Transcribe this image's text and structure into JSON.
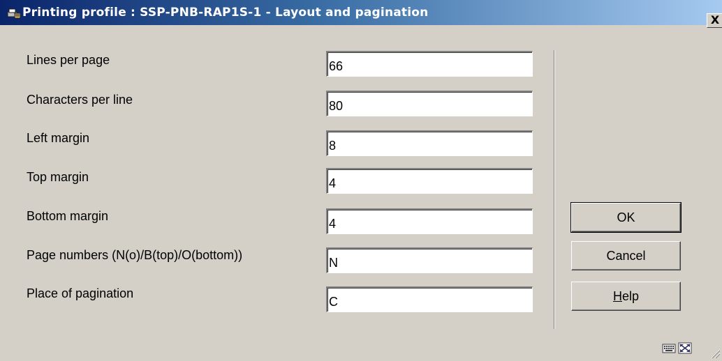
{
  "window": {
    "title": "Printing profile : SSP-PNB-RAP1S-1 - Layout and pagination",
    "close_label": "X"
  },
  "fields": [
    {
      "label": "Lines per page",
      "value": "66"
    },
    {
      "label": "Characters per line",
      "value": "80"
    },
    {
      "label": "Left margin",
      "value": "8"
    },
    {
      "label": "Top margin",
      "value": "4"
    },
    {
      "label": "Bottom margin",
      "value": "4"
    },
    {
      "label": "Page numbers (N(o)/B(top)/O(bottom))",
      "value": "N"
    },
    {
      "label": "Place of pagination",
      "value": "C"
    }
  ],
  "buttons": {
    "ok": "OK",
    "cancel": "Cancel",
    "help_mnemonic": "H",
    "help_rest": "elp"
  },
  "status_icons": [
    "keyboard-icon",
    "maximize-icon",
    "resize-grip-icon"
  ],
  "colors": {
    "title_gradient_start": "#0a246a",
    "title_gradient_end": "#a6caf0",
    "dialog_background": "#d4d0c8"
  }
}
